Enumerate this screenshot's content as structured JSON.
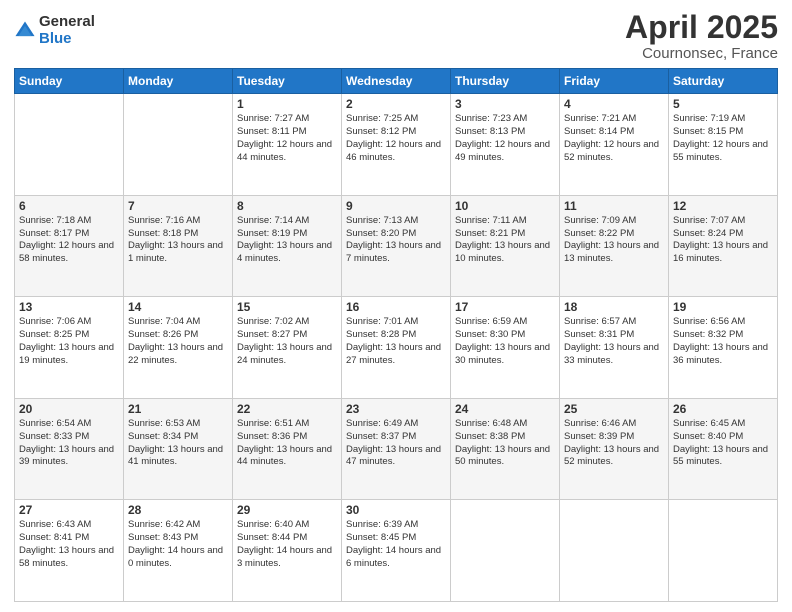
{
  "header": {
    "logo_general": "General",
    "logo_blue": "Blue",
    "title": "April 2025",
    "location": "Cournonsec, France"
  },
  "columns": [
    "Sunday",
    "Monday",
    "Tuesday",
    "Wednesday",
    "Thursday",
    "Friday",
    "Saturday"
  ],
  "weeks": [
    [
      {
        "day": "",
        "info": ""
      },
      {
        "day": "",
        "info": ""
      },
      {
        "day": "1",
        "info": "Sunrise: 7:27 AM\nSunset: 8:11 PM\nDaylight: 12 hours and 44 minutes."
      },
      {
        "day": "2",
        "info": "Sunrise: 7:25 AM\nSunset: 8:12 PM\nDaylight: 12 hours and 46 minutes."
      },
      {
        "day": "3",
        "info": "Sunrise: 7:23 AM\nSunset: 8:13 PM\nDaylight: 12 hours and 49 minutes."
      },
      {
        "day": "4",
        "info": "Sunrise: 7:21 AM\nSunset: 8:14 PM\nDaylight: 12 hours and 52 minutes."
      },
      {
        "day": "5",
        "info": "Sunrise: 7:19 AM\nSunset: 8:15 PM\nDaylight: 12 hours and 55 minutes."
      }
    ],
    [
      {
        "day": "6",
        "info": "Sunrise: 7:18 AM\nSunset: 8:17 PM\nDaylight: 12 hours and 58 minutes."
      },
      {
        "day": "7",
        "info": "Sunrise: 7:16 AM\nSunset: 8:18 PM\nDaylight: 13 hours and 1 minute."
      },
      {
        "day": "8",
        "info": "Sunrise: 7:14 AM\nSunset: 8:19 PM\nDaylight: 13 hours and 4 minutes."
      },
      {
        "day": "9",
        "info": "Sunrise: 7:13 AM\nSunset: 8:20 PM\nDaylight: 13 hours and 7 minutes."
      },
      {
        "day": "10",
        "info": "Sunrise: 7:11 AM\nSunset: 8:21 PM\nDaylight: 13 hours and 10 minutes."
      },
      {
        "day": "11",
        "info": "Sunrise: 7:09 AM\nSunset: 8:22 PM\nDaylight: 13 hours and 13 minutes."
      },
      {
        "day": "12",
        "info": "Sunrise: 7:07 AM\nSunset: 8:24 PM\nDaylight: 13 hours and 16 minutes."
      }
    ],
    [
      {
        "day": "13",
        "info": "Sunrise: 7:06 AM\nSunset: 8:25 PM\nDaylight: 13 hours and 19 minutes."
      },
      {
        "day": "14",
        "info": "Sunrise: 7:04 AM\nSunset: 8:26 PM\nDaylight: 13 hours and 22 minutes."
      },
      {
        "day": "15",
        "info": "Sunrise: 7:02 AM\nSunset: 8:27 PM\nDaylight: 13 hours and 24 minutes."
      },
      {
        "day": "16",
        "info": "Sunrise: 7:01 AM\nSunset: 8:28 PM\nDaylight: 13 hours and 27 minutes."
      },
      {
        "day": "17",
        "info": "Sunrise: 6:59 AM\nSunset: 8:30 PM\nDaylight: 13 hours and 30 minutes."
      },
      {
        "day": "18",
        "info": "Sunrise: 6:57 AM\nSunset: 8:31 PM\nDaylight: 13 hours and 33 minutes."
      },
      {
        "day": "19",
        "info": "Sunrise: 6:56 AM\nSunset: 8:32 PM\nDaylight: 13 hours and 36 minutes."
      }
    ],
    [
      {
        "day": "20",
        "info": "Sunrise: 6:54 AM\nSunset: 8:33 PM\nDaylight: 13 hours and 39 minutes."
      },
      {
        "day": "21",
        "info": "Sunrise: 6:53 AM\nSunset: 8:34 PM\nDaylight: 13 hours and 41 minutes."
      },
      {
        "day": "22",
        "info": "Sunrise: 6:51 AM\nSunset: 8:36 PM\nDaylight: 13 hours and 44 minutes."
      },
      {
        "day": "23",
        "info": "Sunrise: 6:49 AM\nSunset: 8:37 PM\nDaylight: 13 hours and 47 minutes."
      },
      {
        "day": "24",
        "info": "Sunrise: 6:48 AM\nSunset: 8:38 PM\nDaylight: 13 hours and 50 minutes."
      },
      {
        "day": "25",
        "info": "Sunrise: 6:46 AM\nSunset: 8:39 PM\nDaylight: 13 hours and 52 minutes."
      },
      {
        "day": "26",
        "info": "Sunrise: 6:45 AM\nSunset: 8:40 PM\nDaylight: 13 hours and 55 minutes."
      }
    ],
    [
      {
        "day": "27",
        "info": "Sunrise: 6:43 AM\nSunset: 8:41 PM\nDaylight: 13 hours and 58 minutes."
      },
      {
        "day": "28",
        "info": "Sunrise: 6:42 AM\nSunset: 8:43 PM\nDaylight: 14 hours and 0 minutes."
      },
      {
        "day": "29",
        "info": "Sunrise: 6:40 AM\nSunset: 8:44 PM\nDaylight: 14 hours and 3 minutes."
      },
      {
        "day": "30",
        "info": "Sunrise: 6:39 AM\nSunset: 8:45 PM\nDaylight: 14 hours and 6 minutes."
      },
      {
        "day": "",
        "info": ""
      },
      {
        "day": "",
        "info": ""
      },
      {
        "day": "",
        "info": ""
      }
    ]
  ]
}
